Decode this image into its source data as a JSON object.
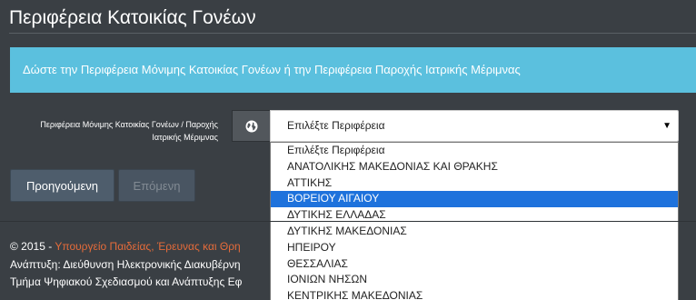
{
  "page": {
    "title": "Περιφέρεια Κατοικίας Γονέων"
  },
  "alert": {
    "text": "Δώστε την Περιφέρεια Μόνιμης Κατοικίας Γονέων ή την Περιφέρεια Παροχής Ιατρικής Μέριμνας"
  },
  "form": {
    "label_line1": "Περιφέρεια Μόνιμης Κατοικίας Γονέων / Παροχής",
    "label_line2": "Ιατρικής Μέριμνας",
    "addon_icon": "globe-icon",
    "select": {
      "value": "Επιλέξτε Περιφέρεια",
      "arrow": "▼"
    },
    "options": [
      "Επιλέξτε Περιφέρεια",
      "ΑΝΑΤΟΛΙΚΗΣ ΜΑΚΕΔΟΝΙΑΣ ΚΑΙ ΘΡΑΚΗΣ",
      "ΑΤΤΙΚΗΣ",
      "ΒΟΡΕΙΟΥ ΑΙΓΑΙΟΥ",
      "ΔΥΤΙΚΗΣ ΕΛΛΑΔΑΣ",
      "ΔΥΤΙΚΗΣ ΜΑΚΕΔΟΝΙΑΣ",
      "ΗΠΕΙΡΟΥ",
      "ΘΕΣΣΑΛΙΑΣ",
      "ΙΟΝΙΩΝ ΝΗΣΩΝ",
      "ΚΕΝΤΡΙΚΗΣ ΜΑΚΕΔΟΝΙΑΣ"
    ],
    "highlighted_option": "ΒΟΡΕΙΟΥ ΑΙΓΑΙΟΥ",
    "highlight_color": "#1e72dc"
  },
  "buttons": {
    "previous": "Προηγούμενη",
    "next": "Επόμενη"
  },
  "footer": {
    "copyright": "© 2015 -",
    "ministry_link": "Υπουργείο Παιδείας, Έρευνας και Θρη",
    "line2": "Ανάπτυξη: Διεύθυνση Ηλεκτρονικής Διακυβέρνη",
    "line3": "Τμήμα Ψηφιακού Σχεδιασμού και Ανάπτυξης Εφ"
  },
  "colors": {
    "background": "#3a3f44",
    "alert": "#5bc0de",
    "button": "#4e5d6c",
    "link": "#e46b3a"
  }
}
